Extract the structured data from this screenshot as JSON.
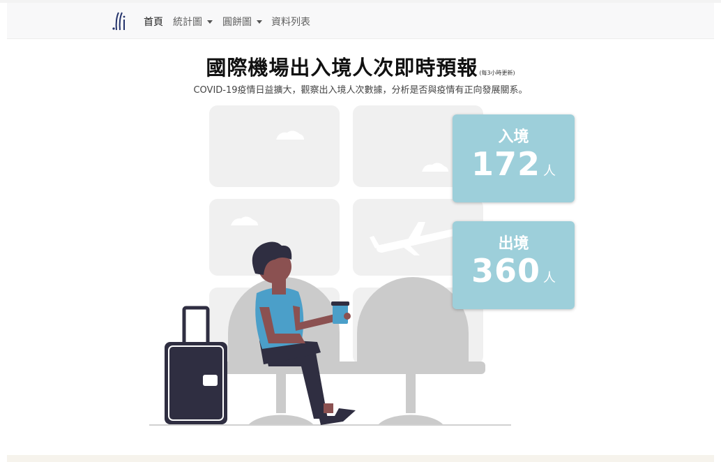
{
  "nav": {
    "items": [
      {
        "label": "首頁"
      },
      {
        "label": "統計圖"
      },
      {
        "label": "圓餅圖"
      },
      {
        "label": "資料列表"
      }
    ]
  },
  "header": {
    "title": "國際機場出入境人次即時預報",
    "note": "(每3小時更新)",
    "subtitle": "COVID-19疫情日益擴大，觀察出入境人次數據，分析是否與疫情有正向發展關系。"
  },
  "stats": {
    "arrival": {
      "label": "入境",
      "value": "172",
      "unit": "人"
    },
    "departure": {
      "label": "出境",
      "value": "360",
      "unit": "人"
    }
  },
  "colors": {
    "card": "#9dcfda",
    "shirt": "#4b9fc9",
    "dark": "#2f2e41",
    "skin": "#8b5151",
    "window": "#f0f0f0",
    "seat": "#cbcbcb"
  }
}
